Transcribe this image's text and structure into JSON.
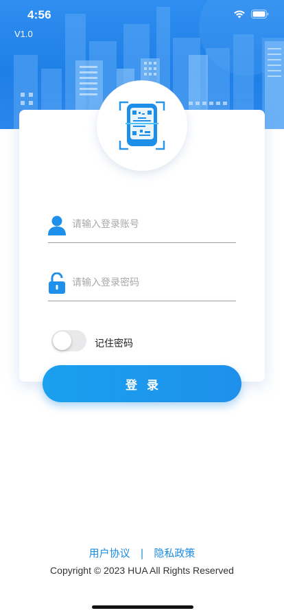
{
  "status_bar": {
    "time": "4:56"
  },
  "version": "V1.0",
  "login_form": {
    "account_placeholder": "请输入登录账号",
    "account_value": "",
    "password_placeholder": "请输入登录密码",
    "password_value": "",
    "remember_label": "记住密码",
    "remember_enabled": false,
    "login_button": "登录"
  },
  "footer": {
    "user_agreement": "用户协议",
    "separator": "|",
    "privacy_policy": "隐私政策",
    "copyright": "Copyright © 2023 HUA All Rights Reserved"
  },
  "colors": {
    "brand_blue": "#1e8ff0",
    "link_blue": "#1b8be0",
    "banner_blue": "#2f8ef0"
  },
  "icons": {
    "logo": "qr-scan-logo",
    "account": "user-icon",
    "password": "lock-icon",
    "signal": "wifi-icon",
    "power": "battery-icon"
  }
}
